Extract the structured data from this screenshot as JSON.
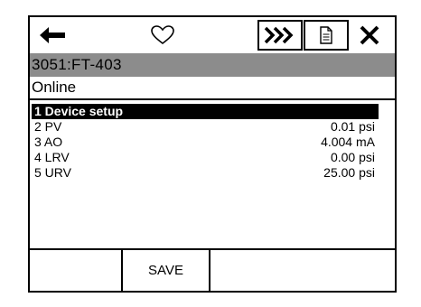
{
  "toolbar": {
    "back_icon": "left-arrow-icon",
    "favorite_icon": "heart-icon",
    "fast_forward_icon": "fast-forward-icon",
    "document_icon": "document-icon",
    "close_icon": "close-icon"
  },
  "device_tag": "3051:FT-403",
  "status": "Online",
  "menu": {
    "items": [
      {
        "label": "1 Device setup",
        "value": ""
      },
      {
        "label": "2 PV",
        "value": "0.01 psi"
      },
      {
        "label": "3 AO",
        "value": "4.004 mA"
      },
      {
        "label": "4 LRV",
        "value": "0.00 psi"
      },
      {
        "label": "5 URV",
        "value": "25.00 psi"
      }
    ]
  },
  "softkeys": {
    "save_label": "SAVE"
  }
}
